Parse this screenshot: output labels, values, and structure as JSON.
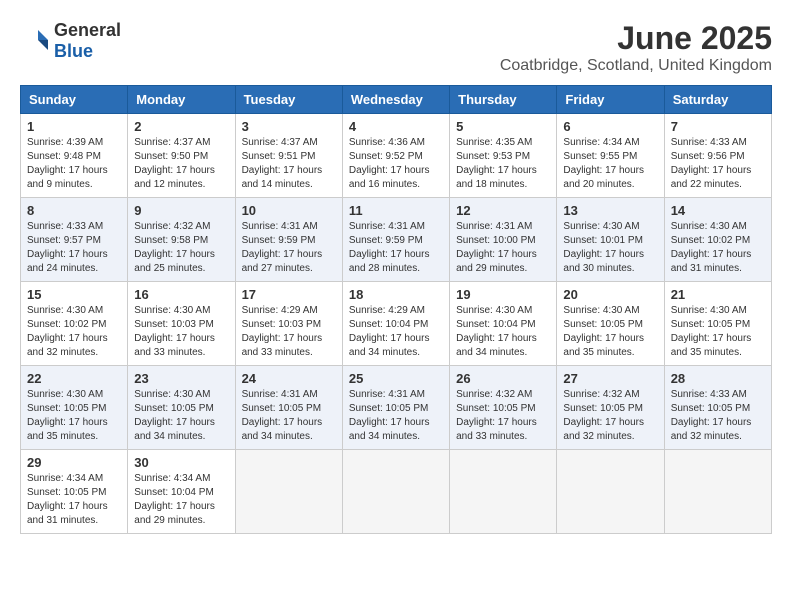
{
  "logo": {
    "text_general": "General",
    "text_blue": "Blue"
  },
  "title": "June 2025",
  "subtitle": "Coatbridge, Scotland, United Kingdom",
  "weekdays": [
    "Sunday",
    "Monday",
    "Tuesday",
    "Wednesday",
    "Thursday",
    "Friday",
    "Saturday"
  ],
  "weeks": [
    [
      {
        "day": 1,
        "info": "Sunrise: 4:39 AM\nSunset: 9:48 PM\nDaylight: 17 hours\nand 9 minutes."
      },
      {
        "day": 2,
        "info": "Sunrise: 4:37 AM\nSunset: 9:50 PM\nDaylight: 17 hours\nand 12 minutes."
      },
      {
        "day": 3,
        "info": "Sunrise: 4:37 AM\nSunset: 9:51 PM\nDaylight: 17 hours\nand 14 minutes."
      },
      {
        "day": 4,
        "info": "Sunrise: 4:36 AM\nSunset: 9:52 PM\nDaylight: 17 hours\nand 16 minutes."
      },
      {
        "day": 5,
        "info": "Sunrise: 4:35 AM\nSunset: 9:53 PM\nDaylight: 17 hours\nand 18 minutes."
      },
      {
        "day": 6,
        "info": "Sunrise: 4:34 AM\nSunset: 9:55 PM\nDaylight: 17 hours\nand 20 minutes."
      },
      {
        "day": 7,
        "info": "Sunrise: 4:33 AM\nSunset: 9:56 PM\nDaylight: 17 hours\nand 22 minutes."
      }
    ],
    [
      {
        "day": 8,
        "info": "Sunrise: 4:33 AM\nSunset: 9:57 PM\nDaylight: 17 hours\nand 24 minutes."
      },
      {
        "day": 9,
        "info": "Sunrise: 4:32 AM\nSunset: 9:58 PM\nDaylight: 17 hours\nand 25 minutes."
      },
      {
        "day": 10,
        "info": "Sunrise: 4:31 AM\nSunset: 9:59 PM\nDaylight: 17 hours\nand 27 minutes."
      },
      {
        "day": 11,
        "info": "Sunrise: 4:31 AM\nSunset: 9:59 PM\nDaylight: 17 hours\nand 28 minutes."
      },
      {
        "day": 12,
        "info": "Sunrise: 4:31 AM\nSunset: 10:00 PM\nDaylight: 17 hours\nand 29 minutes."
      },
      {
        "day": 13,
        "info": "Sunrise: 4:30 AM\nSunset: 10:01 PM\nDaylight: 17 hours\nand 30 minutes."
      },
      {
        "day": 14,
        "info": "Sunrise: 4:30 AM\nSunset: 10:02 PM\nDaylight: 17 hours\nand 31 minutes."
      }
    ],
    [
      {
        "day": 15,
        "info": "Sunrise: 4:30 AM\nSunset: 10:02 PM\nDaylight: 17 hours\nand 32 minutes."
      },
      {
        "day": 16,
        "info": "Sunrise: 4:30 AM\nSunset: 10:03 PM\nDaylight: 17 hours\nand 33 minutes."
      },
      {
        "day": 17,
        "info": "Sunrise: 4:29 AM\nSunset: 10:03 PM\nDaylight: 17 hours\nand 33 minutes."
      },
      {
        "day": 18,
        "info": "Sunrise: 4:29 AM\nSunset: 10:04 PM\nDaylight: 17 hours\nand 34 minutes."
      },
      {
        "day": 19,
        "info": "Sunrise: 4:30 AM\nSunset: 10:04 PM\nDaylight: 17 hours\nand 34 minutes."
      },
      {
        "day": 20,
        "info": "Sunrise: 4:30 AM\nSunset: 10:05 PM\nDaylight: 17 hours\nand 35 minutes."
      },
      {
        "day": 21,
        "info": "Sunrise: 4:30 AM\nSunset: 10:05 PM\nDaylight: 17 hours\nand 35 minutes."
      }
    ],
    [
      {
        "day": 22,
        "info": "Sunrise: 4:30 AM\nSunset: 10:05 PM\nDaylight: 17 hours\nand 35 minutes."
      },
      {
        "day": 23,
        "info": "Sunrise: 4:30 AM\nSunset: 10:05 PM\nDaylight: 17 hours\nand 34 minutes."
      },
      {
        "day": 24,
        "info": "Sunrise: 4:31 AM\nSunset: 10:05 PM\nDaylight: 17 hours\nand 34 minutes."
      },
      {
        "day": 25,
        "info": "Sunrise: 4:31 AM\nSunset: 10:05 PM\nDaylight: 17 hours\nand 34 minutes."
      },
      {
        "day": 26,
        "info": "Sunrise: 4:32 AM\nSunset: 10:05 PM\nDaylight: 17 hours\nand 33 minutes."
      },
      {
        "day": 27,
        "info": "Sunrise: 4:32 AM\nSunset: 10:05 PM\nDaylight: 17 hours\nand 32 minutes."
      },
      {
        "day": 28,
        "info": "Sunrise: 4:33 AM\nSunset: 10:05 PM\nDaylight: 17 hours\nand 32 minutes."
      }
    ],
    [
      {
        "day": 29,
        "info": "Sunrise: 4:34 AM\nSunset: 10:05 PM\nDaylight: 17 hours\nand 31 minutes."
      },
      {
        "day": 30,
        "info": "Sunrise: 4:34 AM\nSunset: 10:04 PM\nDaylight: 17 hours\nand 29 minutes."
      },
      {
        "day": null,
        "info": ""
      },
      {
        "day": null,
        "info": ""
      },
      {
        "day": null,
        "info": ""
      },
      {
        "day": null,
        "info": ""
      },
      {
        "day": null,
        "info": ""
      }
    ]
  ]
}
